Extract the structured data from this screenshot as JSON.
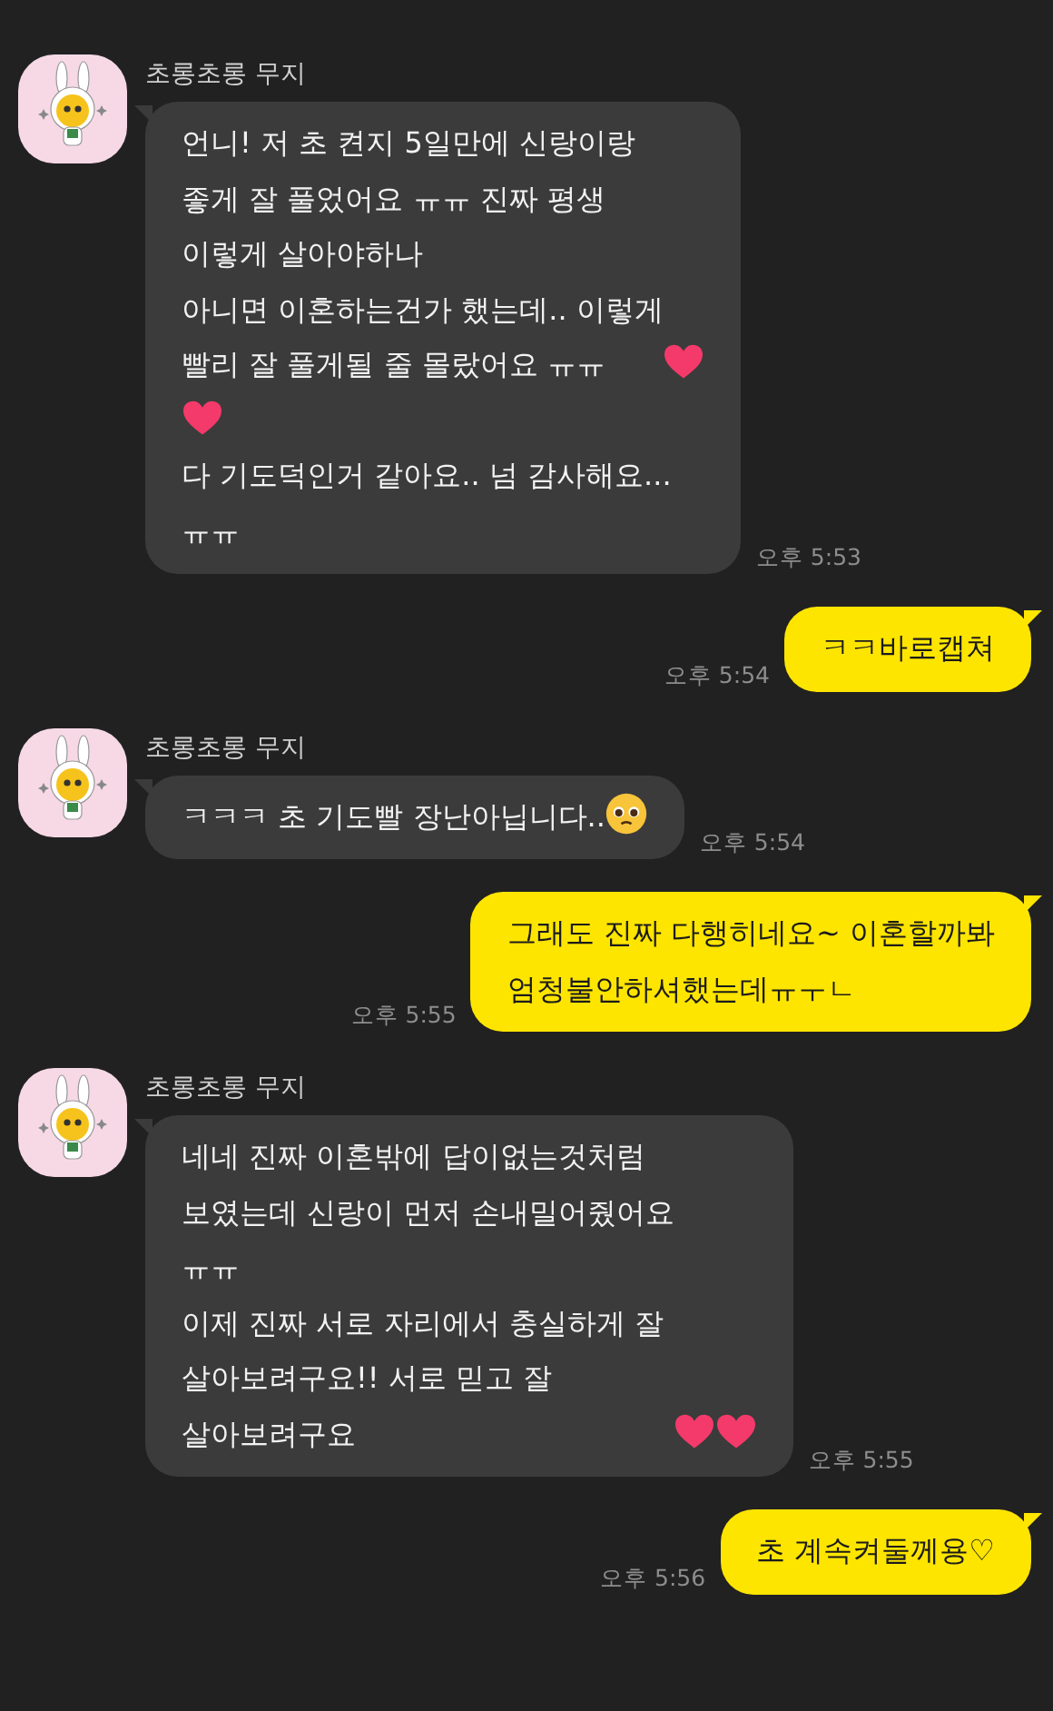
{
  "messages": [
    {
      "kind": "received",
      "sender": "초롱초롱 무지",
      "time": "오후 5:53",
      "parts": [
        {
          "kind": "text",
          "text": "언니! 저 초 켠지 5일만에 신랑이랑\n좋게 잘 풀었어요 ㅠㅠ 진짜 평생\n이렇게 살아야하나\n아니면 이혼하는건가 했는데.. 이렇게\n빨리 잘 풀게될 줄 몰랐어요 ㅠㅠ "
        },
        {
          "kind": "heart"
        },
        {
          "kind": "break"
        },
        {
          "kind": "heart"
        },
        {
          "kind": "break"
        },
        {
          "kind": "text",
          "text": "다 기도덕인거 같아요.. 넘 감사해요...\nㅠㅠ"
        }
      ]
    },
    {
      "kind": "sent",
      "time": "오후 5:54",
      "parts": [
        {
          "kind": "text",
          "text": "ㅋㅋ바로캡쳐"
        }
      ]
    },
    {
      "kind": "received",
      "sender": "초롱초롱 무지",
      "time": "오후 5:54",
      "parts": [
        {
          "kind": "text",
          "text": "ㅋㅋㅋ 초 기도빨 장난아닙니다.."
        },
        {
          "kind": "pleading"
        }
      ]
    },
    {
      "kind": "sent",
      "time": "오후 5:55",
      "parts": [
        {
          "kind": "text",
          "text": "그래도 진짜 다행히네요~ 이혼할까봐\n엄청불안하셔했는데ㅠㅜㄴ"
        }
      ]
    },
    {
      "kind": "received",
      "sender": "초롱초롱 무지",
      "time": "오후 5:55",
      "parts": [
        {
          "kind": "text",
          "text": "네네 진짜 이혼밖에 답이없는것처럼\n보였는데 신랑이 먼저 손내밀어줬어요\nㅠㅠ\n이제 진짜 서로 자리에서 충실하게 잘\n살아보려구요!! 서로 믿고 잘\n살아보려구요"
        },
        {
          "kind": "heart"
        },
        {
          "kind": "heart"
        }
      ]
    },
    {
      "kind": "sent",
      "time": "오후 5:56",
      "parts": [
        {
          "kind": "text",
          "text": "초 계속켜둘께용♡"
        }
      ]
    }
  ]
}
